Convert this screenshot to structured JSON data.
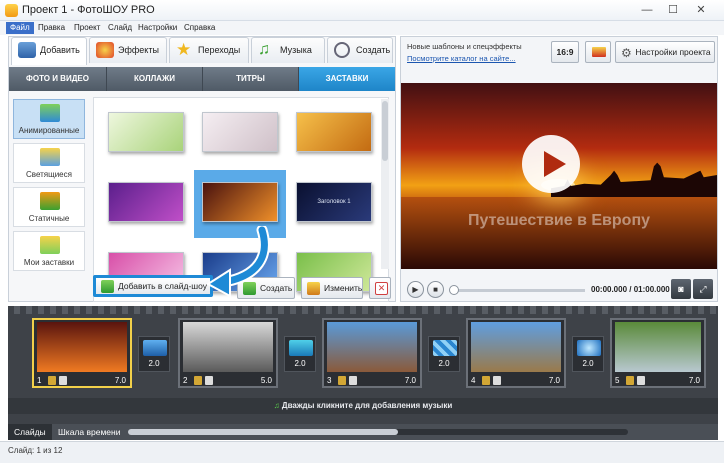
{
  "window": {
    "title": "Проект 1 - ФотоШОУ PRO",
    "minimize": "—",
    "maximize": "☐",
    "close": "✕"
  },
  "menu": [
    "Файл",
    "Правка",
    "Проект",
    "Слайд",
    "Настройки",
    "Справка"
  ],
  "main_tabs": [
    {
      "label": "Добавить",
      "icon": "add-photo-icon"
    },
    {
      "label": "Эффекты",
      "icon": "effects-icon"
    },
    {
      "label": "Переходы",
      "icon": "star-transitions-icon"
    },
    {
      "label": "Музыка",
      "icon": "music-note-icon"
    },
    {
      "label": "Создать",
      "icon": "film-reel-icon"
    }
  ],
  "sub_tabs": [
    "ФОТО И ВИДЕО",
    "КОЛЛАЖИ",
    "ТИТРЫ",
    "ЗАСТАВКИ"
  ],
  "active_sub_tab": "ЗАСТАВКИ",
  "categories": [
    {
      "label": "Анимированные",
      "active": true
    },
    {
      "label": "Светящиеся",
      "active": false
    },
    {
      "label": "Статичные",
      "active": false
    },
    {
      "label": "Мои заставки",
      "active": false
    }
  ],
  "thumbnails": [
    {
      "name": "green-tree",
      "colors": [
        "#eef7de",
        "#a9d37a"
      ]
    },
    {
      "name": "wedding-rings",
      "colors": [
        "#f5eef2",
        "#cfc0c8"
      ]
    },
    {
      "name": "autumn-tree",
      "colors": [
        "#f6c04a",
        "#c36b12"
      ]
    },
    {
      "name": "purple-glow",
      "colors": [
        "#5b1f8c",
        "#c04fc8"
      ]
    },
    {
      "name": "sunset-selected",
      "colors": [
        "#4a120e",
        "#f0902a"
      ]
    },
    {
      "name": "dark-title",
      "colors": [
        "#0a1030",
        "#2a3a7a"
      ],
      "text": "Заголовок 1"
    },
    {
      "name": "pink-heart",
      "colors": [
        "#d84fa8",
        "#f6c3e6"
      ]
    },
    {
      "name": "blue-light",
      "colors": [
        "#1a3c8a",
        "#6aa8f0"
      ]
    },
    {
      "name": "green-field",
      "colors": [
        "#7abf4a",
        "#cfe89a"
      ]
    }
  ],
  "panel_buttons": {
    "add_to_slideshow": "Добавить в слайд-шоу",
    "create": "Создать",
    "edit": "Изменить"
  },
  "news": {
    "line1": "Новые шаблоны и спецэффекты",
    "link": "Посмотрите каталог на сайте..."
  },
  "right_buttons": {
    "aspect": "16:9",
    "settings": "Настройки проекта"
  },
  "preview": {
    "caption": "Путешествие в Европу",
    "time": "00:00.000 / 01:00.000",
    "progress": 0
  },
  "slides": [
    {
      "num": "1",
      "duration": "7.0",
      "colors": [
        "#5a140e",
        "#f07a22"
      ],
      "selected": true
    },
    {
      "num": "2",
      "duration": "5.0",
      "colors": [
        "#d8d8d8",
        "#5a5a5a"
      ],
      "selected": false
    },
    {
      "num": "3",
      "duration": "7.0",
      "colors": [
        "#5a9ad8",
        "#8a5a3a"
      ],
      "selected": false
    },
    {
      "num": "4",
      "duration": "7.0",
      "colors": [
        "#5f9ee0",
        "#9a7a4a"
      ],
      "selected": false
    },
    {
      "num": "5",
      "duration": "7.0",
      "colors": [
        "#5a8a3a",
        "#b8c8d0"
      ],
      "selected": false
    }
  ],
  "transitions": [
    "2.0",
    "2.0",
    "2.0",
    "2.0",
    "2.0"
  ],
  "music_hint": "Дважды кликните для добавления музыки",
  "bottom_tabs": [
    "Слайды",
    "Шкала времени"
  ],
  "status": "Слайд: 1 из 12"
}
